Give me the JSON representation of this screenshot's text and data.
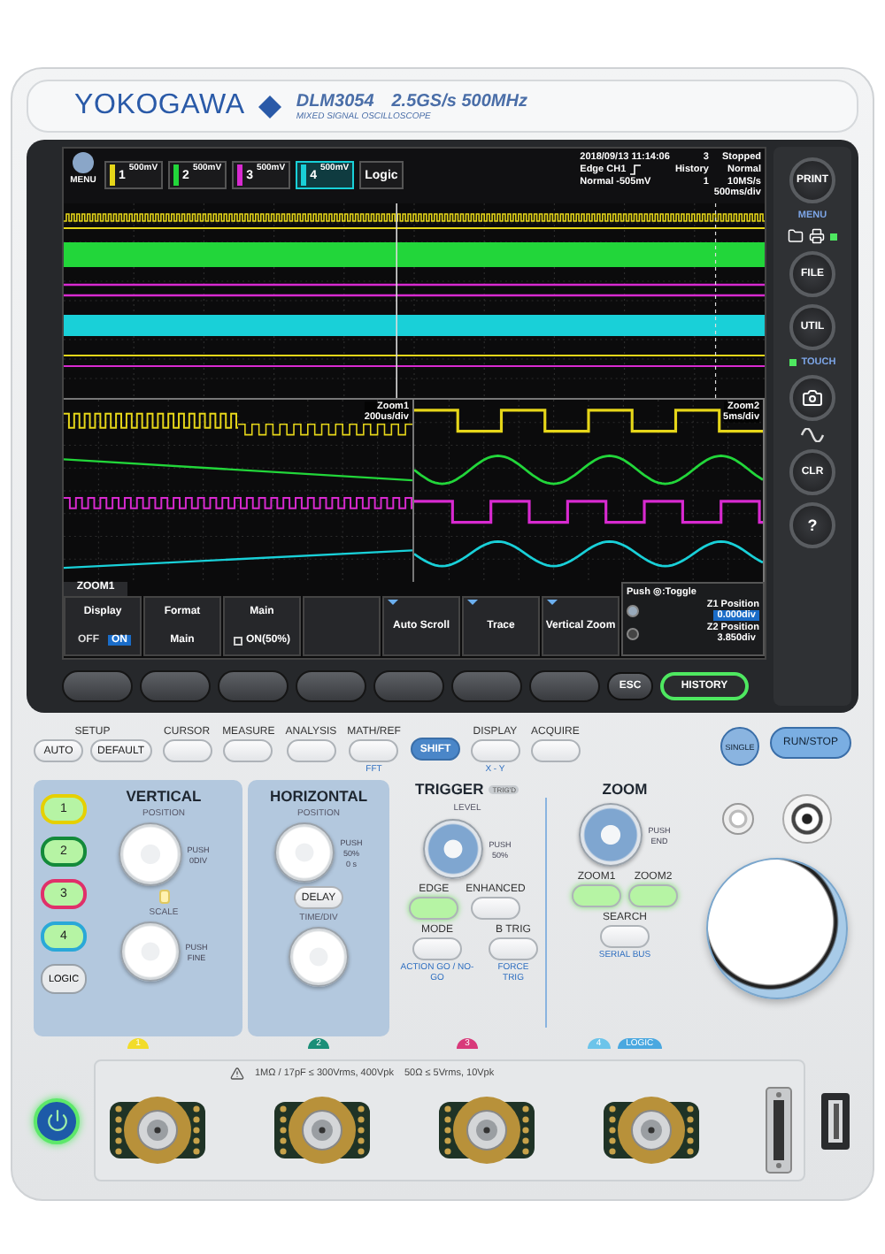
{
  "brand": {
    "logo": "YOKOGAWA",
    "model": "DLM3054",
    "spec": "2.5GS/s 500MHz",
    "subtitle": "MIXED SIGNAL OSCILLOSCOPE"
  },
  "display": {
    "menu_label": "MENU",
    "channels": [
      {
        "label": "1",
        "scale": "500mV",
        "color": "#e6d619",
        "selected": false
      },
      {
        "label": "2",
        "scale": "500mV",
        "color": "#22d63a",
        "selected": false
      },
      {
        "label": "3",
        "scale": "500mV",
        "color": "#d82ad0",
        "selected": false
      },
      {
        "label": "4",
        "scale": "500mV",
        "color": "#19d0d8",
        "selected": true
      }
    ],
    "logic_label": "Logic",
    "datetime": "2018/09/13 11:14:06",
    "trigger_type": "Edge CH1",
    "trigger_level": "Normal -505mV",
    "history_count": "3",
    "history_label": "History",
    "history_index": "1",
    "status": "Stopped",
    "trigger_mode": "Normal",
    "sample_rate": "10MS/s",
    "time_div": "500ms/div",
    "zoom_windows": [
      {
        "title": "Zoom1",
        "time_div": "200us/div"
      },
      {
        "title": "Zoom2",
        "time_div": "5ms/div"
      }
    ],
    "soft_menu": {
      "title": "ZOOM1",
      "items": [
        {
          "kind": "toggle",
          "label": "Display",
          "options": [
            {
              "label": "OFF",
              "selected": false
            },
            {
              "label": "ON",
              "selected": true
            }
          ]
        },
        {
          "kind": "value",
          "label": "Format",
          "value": "Main"
        },
        {
          "kind": "value",
          "label": "Main",
          "value": "ON(50%)"
        },
        {
          "kind": "empty"
        },
        {
          "kind": "action",
          "label": "Auto Scroll"
        },
        {
          "kind": "action",
          "label": "Trace"
        },
        {
          "kind": "action",
          "label": "Vertical Zoom"
        }
      ]
    },
    "position_panel": {
      "hint": "Push ◎:Toggle",
      "rows": [
        {
          "label": "Z1 Position",
          "value": "0.000div",
          "selected": true
        },
        {
          "label": "Z2 Position",
          "value": "3.850div",
          "selected": false
        }
      ]
    }
  },
  "bezel_keys": {
    "escape": "ESC",
    "history": "HISTORY"
  },
  "side_panel": {
    "print": "PRINT",
    "menu": "MENU",
    "file": "FILE",
    "util": "UTIL",
    "touch": "TOUCH",
    "clear": "CLR",
    "help": "?"
  },
  "setup": {
    "title": "SETUP",
    "keys": [
      "AUTO",
      "DEFAULT"
    ]
  },
  "function_keys": [
    {
      "title": "CURSOR"
    },
    {
      "title": "MEASURE"
    },
    {
      "title": "ANALYSIS"
    },
    {
      "title": "MATH/REF",
      "shift_label": "FFT"
    }
  ],
  "shift_key": "SHIFT",
  "function_keys_2": [
    {
      "title": "DISPLAY",
      "shift_label": "X - Y"
    },
    {
      "title": "ACQUIRE"
    }
  ],
  "run_keys": {
    "single": "SINGLE",
    "run_stop": "RUN/STOP"
  },
  "vertical": {
    "title": "VERTICAL",
    "position_label": "POSITION",
    "position_push": [
      "PUSH",
      "0DIV"
    ],
    "scale_label": "SCALE",
    "scale_push": [
      "PUSH",
      "FINE"
    ],
    "channel_keys": [
      {
        "label": "1",
        "color": "#e6d000",
        "lit": true
      },
      {
        "label": "2",
        "color": "#138a3a",
        "lit": true
      },
      {
        "label": "3",
        "color": "#e0306a",
        "lit": true
      },
      {
        "label": "4",
        "color": "#2aa8d8",
        "lit": true
      }
    ],
    "logic_key": {
      "label": "LOGIC",
      "lit": false
    },
    "badge": {
      "label": "1",
      "color": "#f2dc2a"
    }
  },
  "horizontal": {
    "title": "HORIZONTAL",
    "position_label": "POSITION",
    "position_push": [
      "PUSH",
      "50%",
      "0 s"
    ],
    "delay": "DELAY",
    "time_div_label": "TIME/DIV",
    "badge": {
      "label": "2",
      "color": "#1b8f78"
    }
  },
  "trigger": {
    "title": "TRIGGER",
    "trigd": "TRIG'D",
    "level_label": "LEVEL",
    "push": [
      "PUSH",
      "50%"
    ],
    "keys": [
      {
        "label": "EDGE",
        "lit": true
      },
      {
        "label": "ENHANCED",
        "lit": false
      },
      {
        "label": "MODE",
        "lit": false,
        "shift_label": "ACTION GO / NO-GO"
      },
      {
        "label": "B TRIG",
        "lit": false,
        "shift_label": "FORCE TRIG"
      }
    ],
    "badge": {
      "label": "3",
      "color": "#d83a7a"
    }
  },
  "zoom": {
    "title": "ZOOM",
    "push": [
      "PUSH",
      "END"
    ],
    "keys": [
      {
        "label": "ZOOM1",
        "lit": true
      },
      {
        "label": "ZOOM2",
        "lit": true
      }
    ],
    "search": {
      "label": "SEARCH",
      "lit": false,
      "shift_label": "SERIAL BUS"
    },
    "badges": [
      {
        "label": "4",
        "color": "#6cc4ea"
      },
      {
        "label": "LOGIC",
        "color": "#4aa8e0"
      }
    ]
  },
  "front": {
    "power": {
      "on": true
    },
    "rating_1": "1MΩ / 17pF ≤ 300Vrms, 400Vpk",
    "rating_2": "50Ω ≤ 5Vrms, 10Vpk"
  }
}
